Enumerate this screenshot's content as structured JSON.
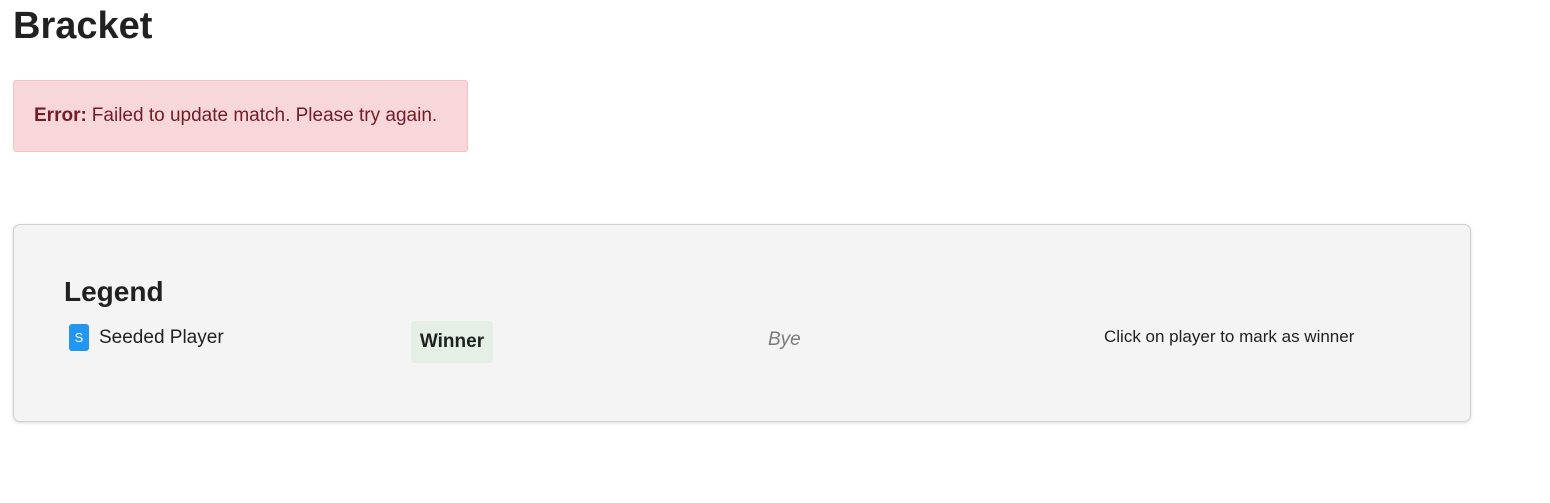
{
  "page": {
    "title": "Bracket"
  },
  "alert": {
    "label": "Error:",
    "message": "Failed to update match. Please try again.",
    "background_color": "#f8d7da",
    "text_color": "#721c24"
  },
  "legend": {
    "title": "Legend",
    "seed_badge_letter": "S",
    "seed_badge_color": "#2196f3",
    "seeded_label": "Seeded Player",
    "winner_label": "Winner",
    "winner_color": "#e5efe5",
    "bye_label": "Bye",
    "hint": "Click on player to mark as winner"
  }
}
